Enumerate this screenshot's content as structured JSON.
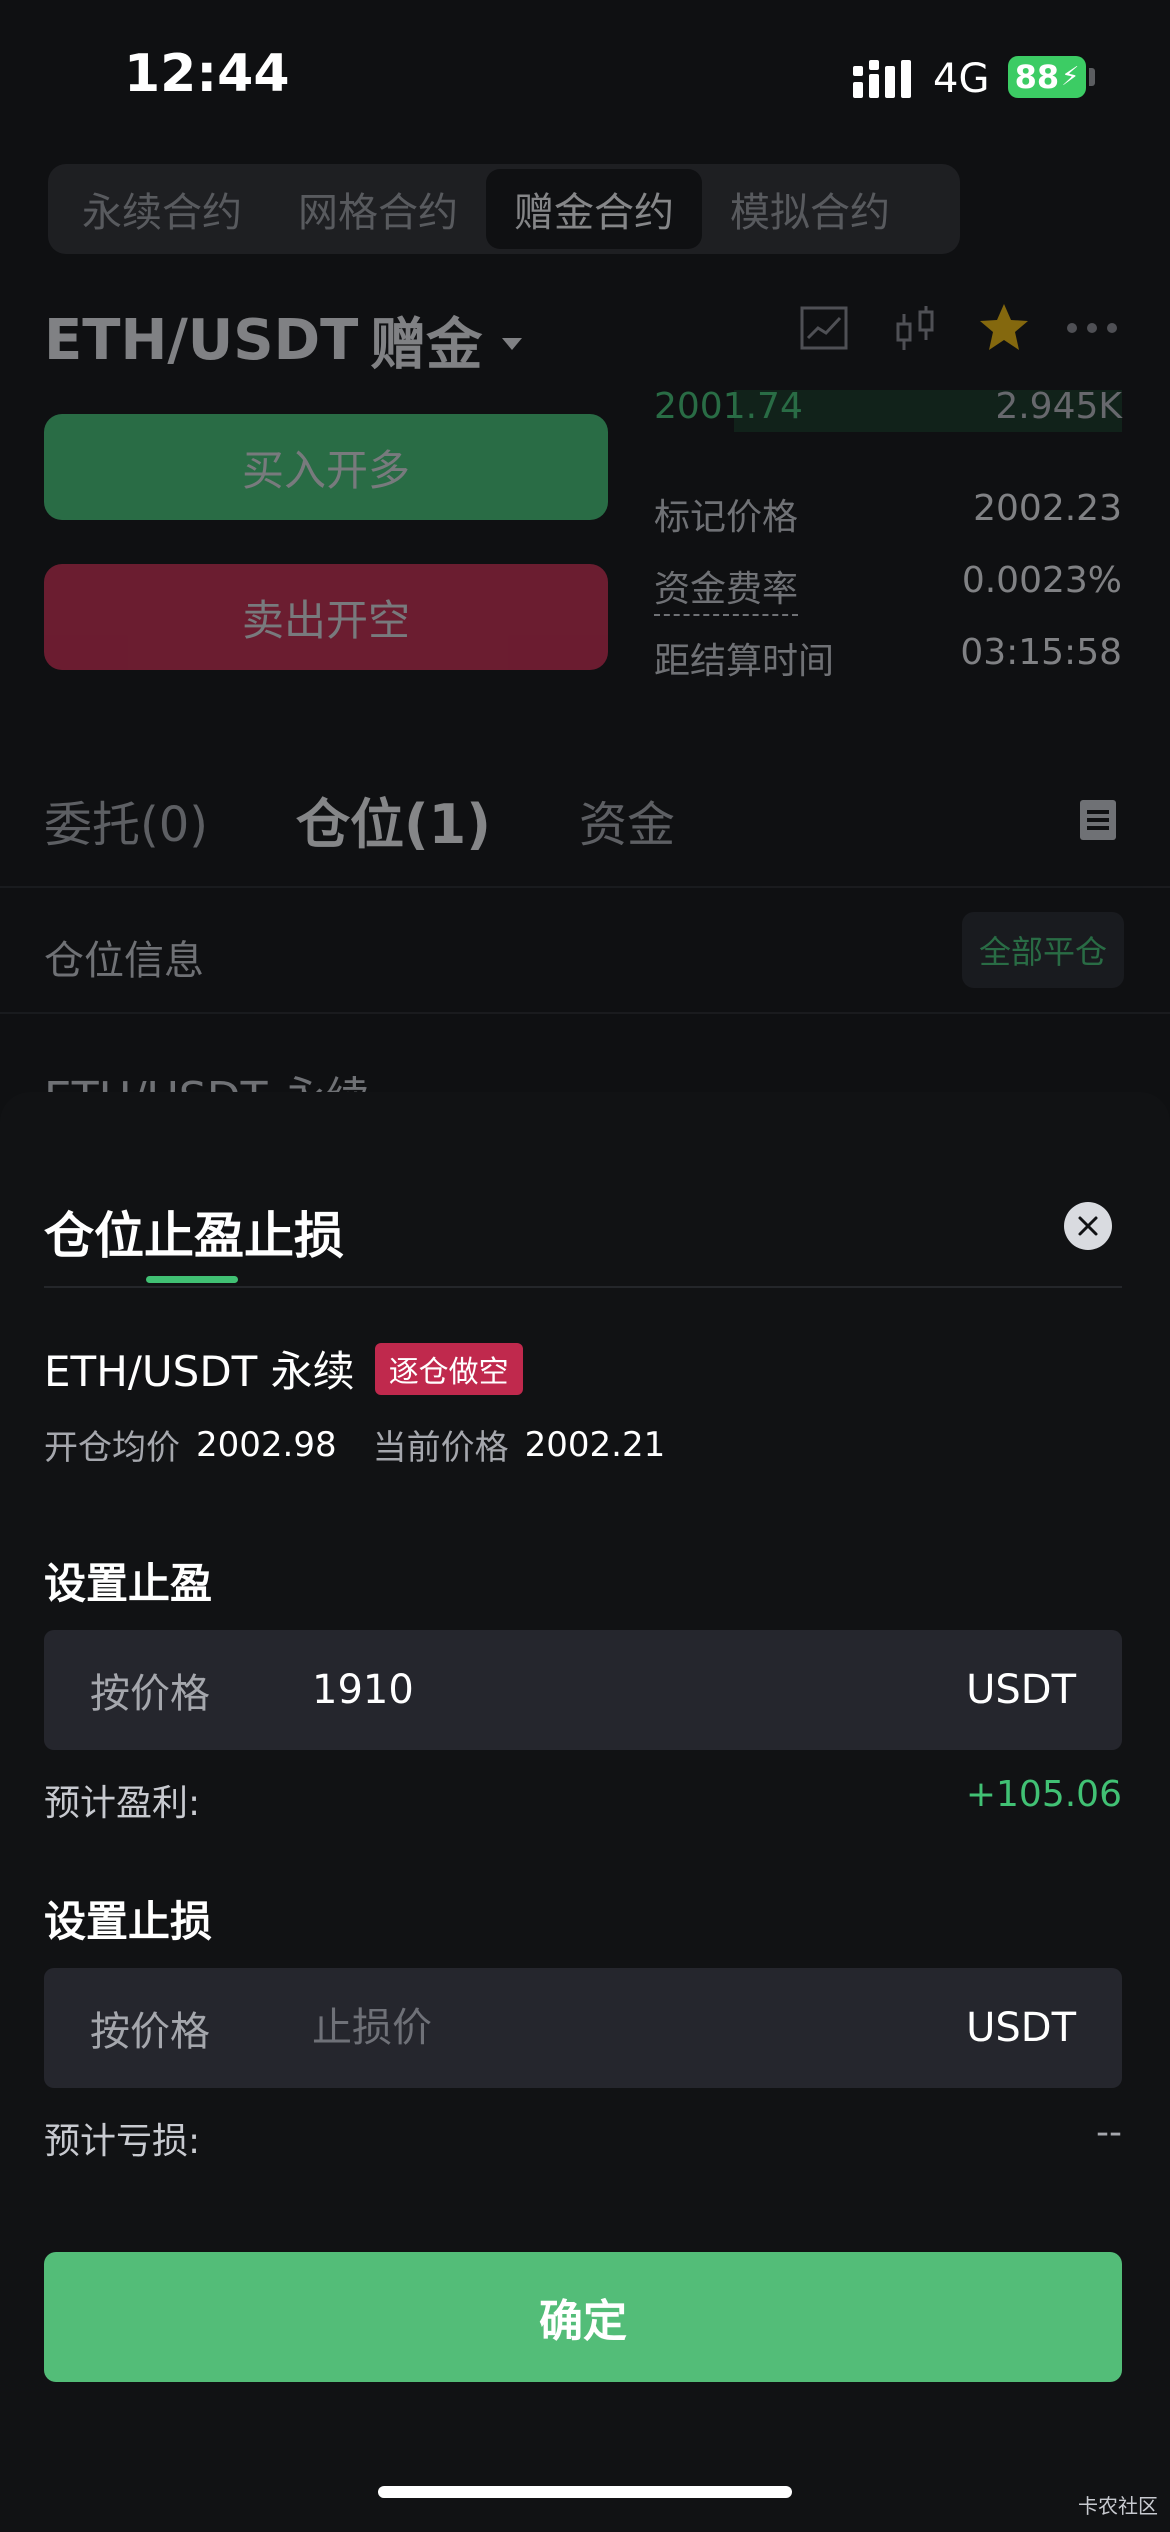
{
  "status_bar": {
    "time": "12:44",
    "network": "4G",
    "battery": "88"
  },
  "background": {
    "mode_tabs": [
      "永续合约",
      "网格合约",
      "赠金合约",
      "模拟合约"
    ],
    "active_mode_index": 2,
    "pair": {
      "symbol": "ETH/USDT",
      "tag": "赠金"
    },
    "buy_button": "买入开多",
    "sell_button": "卖出开空",
    "book_top": {
      "price": "2001.74",
      "amount": "2.945K"
    },
    "stats": [
      {
        "label": "标记价格",
        "value": "2002.23"
      },
      {
        "label": "资金费率",
        "value": "0.0023%"
      },
      {
        "label": "距结算时间",
        "value": "03:15:58"
      }
    ],
    "tabs": [
      "委托(0)",
      "仓位(1)",
      "资金"
    ],
    "active_tab_index": 1,
    "position_info_label": "仓位信息",
    "close_all_button": "全部平仓",
    "position_peek": "ETH/USDT 永续"
  },
  "sheet": {
    "title": "仓位止盈止损",
    "position": {
      "name": "ETH/USDT 永续",
      "tag": "逐仓做空"
    },
    "open_avg_label": "开仓均价",
    "open_avg_value": "2002.98",
    "current_price_label": "当前价格",
    "current_price_value": "2002.21",
    "take_profit": {
      "title": "设置止盈",
      "mode": "按价格",
      "value": "1910",
      "placeholder": "",
      "unit": "USDT",
      "estimate_label": "预计盈利:",
      "estimate_value": "+105.06"
    },
    "stop_loss": {
      "title": "设置止损",
      "mode": "按价格",
      "value": "",
      "placeholder": "止损价",
      "unit": "USDT",
      "estimate_label": "预计亏损:",
      "estimate_value": "--"
    },
    "confirm_button": "确定"
  },
  "watermark": "卡农社区",
  "colors": {
    "accent_green": "#41c174",
    "sell_red": "#c0294d",
    "background": "#0f1012",
    "field_bg": "#25262d"
  }
}
